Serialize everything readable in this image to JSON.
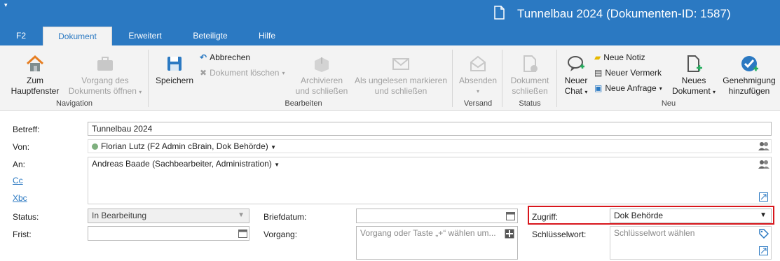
{
  "window": {
    "title": "Tunnelbau 2024 (Dokumenten-ID: 1587)",
    "quick_access": "▾"
  },
  "tabs": [
    {
      "label": "F2",
      "active": false
    },
    {
      "label": "Dokument",
      "active": true
    },
    {
      "label": "Erweitert",
      "active": false
    },
    {
      "label": "Beteiligte",
      "active": false
    },
    {
      "label": "Hilfe",
      "active": false
    }
  ],
  "ribbon": {
    "groups": {
      "navigation": "Navigation",
      "bearbeiten": "Bearbeiten",
      "versand": "Versand",
      "status": "Status",
      "neu": "Neu"
    },
    "zum_hauptfenster": [
      "Zum",
      "Hauptfenster"
    ],
    "vorgang_oeffnen": [
      "Vorgang des",
      "Dokuments öffnen"
    ],
    "speichern": "Speichern",
    "abbrechen": "Abbrechen",
    "dokument_loeschen": "Dokument löschen",
    "archivieren": [
      "Archivieren",
      "und schließen"
    ],
    "ungelesen": [
      "Als ungelesen markieren",
      "und schließen"
    ],
    "absenden": "Absenden",
    "dokument_schliessen": [
      "Dokument",
      "schließen"
    ],
    "neuer_chat": [
      "Neuer",
      "Chat"
    ],
    "neue_notiz": "Neue Notiz",
    "neuer_vermerk": "Neuer Vermerk",
    "neue_anfrage": "Neue Anfrage",
    "neues_dokument": [
      "Neues",
      "Dokument"
    ],
    "genehmigung": [
      "Genehmigung",
      "hinzufügen"
    ],
    "colors": {
      "accent": "#2b79c2",
      "highlight": "#d8161c"
    }
  },
  "form": {
    "betreff_label": "Betreff:",
    "betreff_value": "Tunnelbau 2024",
    "von_label": "Von:",
    "von_value": "Florian Lutz (F2 Admin cBrain, Dok Behörde)",
    "an_label": "An:",
    "an_value": "Andreas Baade (Sachbearbeiter, Administration)",
    "cc_label": "Cc",
    "bcc_label": "Xbc",
    "status_label": "Status:",
    "status_value": "In Bearbeitung",
    "frist_label": "Frist:",
    "briefdatum_label": "Briefdatum:",
    "vorgang_label": "Vorgang:",
    "vorgang_placeholder": "Vorgang oder Taste „+“ wählen um...",
    "zugriff_label": "Zugriff:",
    "zugriff_value": "Dok Behörde",
    "schluesselwort_label": "Schlüsselwort:",
    "schluesselwort_placeholder": "Schlüsselwort wählen"
  }
}
